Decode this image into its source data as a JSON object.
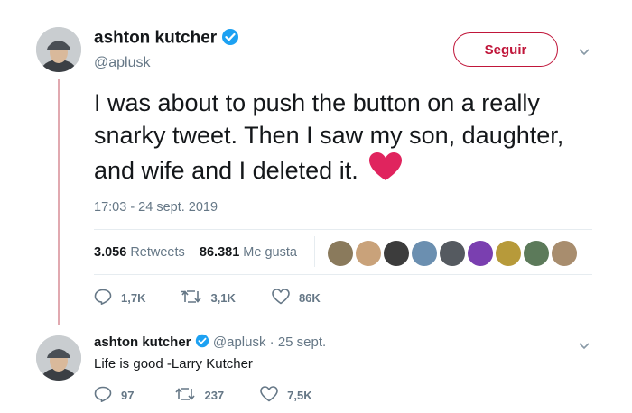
{
  "main_tweet": {
    "author_name": "ashton kutcher",
    "handle": "@aplusk",
    "follow_label": "Seguir",
    "text": "I was about to push the button on a really snarky tweet. Then I saw my son, daughter, and wife and I deleted it.",
    "timestamp": "17:03 - 24 sept. 2019",
    "retweets_count": "3.056",
    "retweets_label": "Retweets",
    "likes_count": "86.381",
    "likes_label": "Me gusta",
    "reply_count": "1,7K",
    "retweet_count_short": "3,1K",
    "like_count_short": "86K"
  },
  "reply_tweet": {
    "author_name": "ashton kutcher",
    "handle": "@aplusk",
    "separator": "·",
    "date": "25 sept.",
    "text": "Life is good -Larry Kutcher",
    "reply_count": "97",
    "retweet_count": "237",
    "like_count": "7,5K"
  },
  "colors": {
    "follow_accent": "#c0163a",
    "verified": "#1da1f2",
    "secondary_text": "#657786",
    "heart": "#e0245e"
  },
  "icons": [
    "verified-badge-icon",
    "chevron-down-icon",
    "reply-icon",
    "retweet-icon",
    "like-icon",
    "heart-emoji-icon"
  ]
}
